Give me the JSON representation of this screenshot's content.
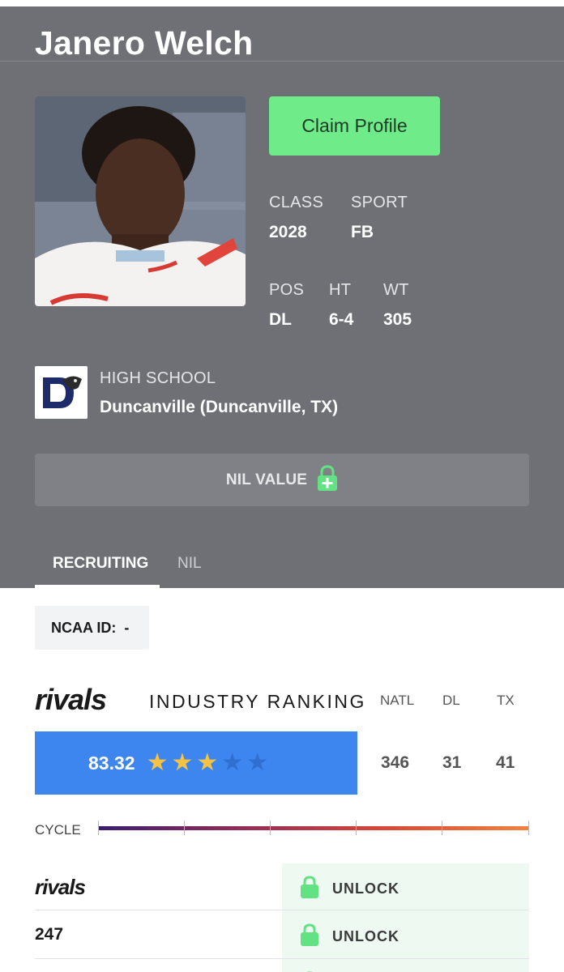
{
  "player": {
    "name": "Janero Welch",
    "claim_label": "Claim Profile"
  },
  "stats": {
    "class_label": "CLASS",
    "class_value": "2028",
    "sport_label": "SPORT",
    "sport_value": "FB",
    "pos_label": "POS",
    "pos_value": "DL",
    "ht_label": "HT",
    "ht_value": "6-4",
    "wt_label": "WT",
    "wt_value": "305"
  },
  "school": {
    "label": "HIGH SCHOOL",
    "name": "Duncanville (Duncanville, TX)"
  },
  "nil": {
    "label": "NIL VALUE"
  },
  "tabs": [
    {
      "label": "RECRUITING",
      "active": true
    },
    {
      "label": "NIL",
      "active": false
    }
  ],
  "ncaa": {
    "label": "NCAA ID:",
    "value": "-"
  },
  "ranking": {
    "brand": "rivals",
    "title": "INDUSTRY RANKING",
    "columns": [
      "NATL",
      "DL",
      "TX"
    ],
    "rating": "83.32",
    "stars": 3,
    "max_stars": 5,
    "ranks": [
      "346",
      "31",
      "41"
    ]
  },
  "cycle": {
    "label": "CYCLE"
  },
  "services": [
    {
      "name": "rivals",
      "action": "UNLOCK"
    },
    {
      "name": "247",
      "action": "UNLOCK"
    }
  ],
  "colors": {
    "header_bg": "#6e7076",
    "claim_green": "#6feb8a",
    "rating_blue": "#3d86f0",
    "star_gold": "#f5c242",
    "star_empty": "#2f6fd0",
    "lock_green": "#62e283"
  }
}
